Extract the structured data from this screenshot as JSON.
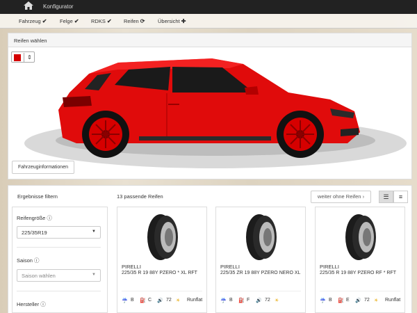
{
  "header": {
    "brand": "Konfigurator",
    "home_icon": "home-icon"
  },
  "breadcrumbs": [
    {
      "label": "Fahrzeug",
      "mark": "✔"
    },
    {
      "label": "Felge",
      "mark": "✔"
    },
    {
      "label": "RDKS",
      "mark": "✔"
    },
    {
      "label": "Reifen",
      "mark": "⟳"
    },
    {
      "label": "Übersicht",
      "mark": "✚"
    }
  ],
  "preview": {
    "title": "Reifen wählen",
    "color": "#d40000",
    "info_button": "Fahrzeuginformationen"
  },
  "results": {
    "filter_title": "Ergebnisse filtern",
    "count_label": "13 passende Reifen",
    "skip_button": "weiter ohne Reifen",
    "skip_icon": "chevron-right-icon"
  },
  "filters": {
    "size_label": "Reifengröße",
    "size_value": "225/35R19",
    "season_label": "Saison",
    "season_placeholder": "Saison wählen",
    "maker_label": "Hersteller"
  },
  "tires": [
    {
      "brand": "PIRELLI",
      "model": "225/35 R 19 88Y PZERO * XL RFT",
      "wet": "B",
      "fuel": "C",
      "noise": "72",
      "extra": "Runflat"
    },
    {
      "brand": "PIRELLI",
      "model": "225/35 ZR 19 88Y PZERO NERO XL",
      "wet": "B",
      "fuel": "F",
      "noise": "72",
      "extra": ""
    },
    {
      "brand": "PIRELLI",
      "model": "225/35 R 19 88Y PZERO RF * RFT",
      "wet": "B",
      "fuel": "E",
      "noise": "72",
      "extra": "Runflat"
    }
  ]
}
